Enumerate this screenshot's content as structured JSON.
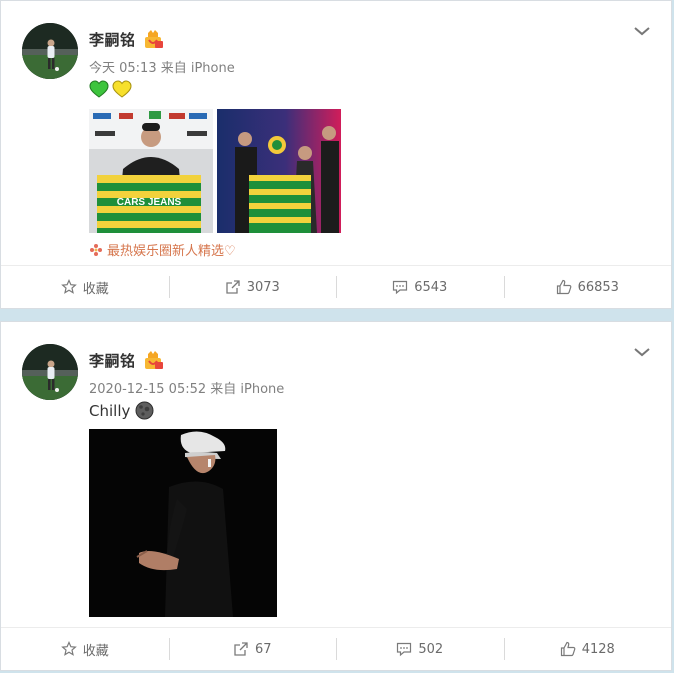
{
  "posts": [
    {
      "username": "李嗣铭",
      "meta": "今天 05:13 来自 iPhone",
      "source_tag": "最热娱乐圈新人精选♡",
      "actions": {
        "favorite": "收藏",
        "forward": "3073",
        "comment": "6543",
        "like": "66853"
      },
      "jersey_text": "CARS JEANS"
    },
    {
      "username": "李嗣铭",
      "meta": "2020-12-15 05:52 来自 iPhone",
      "text": "Chilly",
      "actions": {
        "favorite": "收藏",
        "forward": "67",
        "comment": "502",
        "like": "4128"
      }
    }
  ],
  "colors": {
    "page_bg": "#cfe3ec",
    "source_tag": "#d6764d",
    "meta": "#808080",
    "username": "#333333"
  },
  "icons": [
    "chevron-down-icon",
    "vip-badge-icon",
    "green-heart-icon",
    "yellow-heart-icon",
    "flower-icon",
    "star-icon",
    "forward-icon",
    "comment-icon",
    "like-icon",
    "moon-emoji-icon"
  ]
}
